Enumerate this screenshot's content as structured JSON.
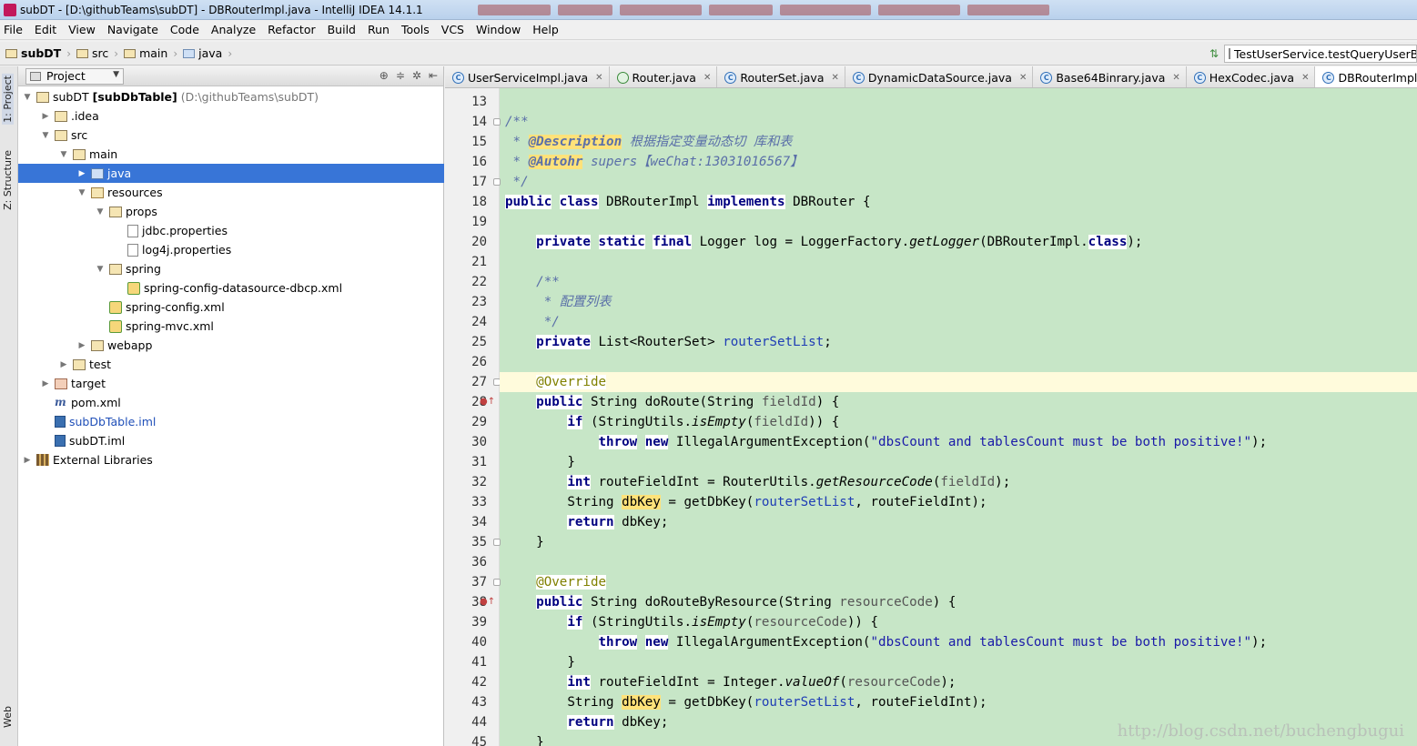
{
  "window": {
    "title": "subDT - [D:\\githubTeams\\subDT] - DBRouterImpl.java - IntelliJ IDEA 14.1.1"
  },
  "menu": [
    "File",
    "Edit",
    "View",
    "Navigate",
    "Code",
    "Analyze",
    "Refactor",
    "Build",
    "Run",
    "Tools",
    "VCS",
    "Window",
    "Help"
  ],
  "breadcrumb": [
    "subDT",
    "src",
    "main",
    "java"
  ],
  "run_config": {
    "label": "TestUserService.testQueryUserByI"
  },
  "side_tabs": {
    "project": "1: Project",
    "structure": "Z: Structure",
    "web": "Web"
  },
  "project_panel": {
    "view_mode": "Project",
    "tree": [
      {
        "name": "subDT",
        "extra": "[subDbTable]",
        "path": "(D:\\githubTeams\\subDT)",
        "depth": 0,
        "arrow": "down",
        "icon": "module"
      },
      {
        "name": ".idea",
        "depth": 1,
        "arrow": "right",
        "icon": "folder"
      },
      {
        "name": "src",
        "depth": 1,
        "arrow": "down",
        "icon": "folder"
      },
      {
        "name": "main",
        "depth": 2,
        "arrow": "down",
        "icon": "folder"
      },
      {
        "name": "java",
        "depth": 3,
        "arrow": "right",
        "icon": "src",
        "selected": true
      },
      {
        "name": "resources",
        "depth": 3,
        "arrow": "down",
        "icon": "res"
      },
      {
        "name": "props",
        "depth": 4,
        "arrow": "down",
        "icon": "folder"
      },
      {
        "name": "jdbc.properties",
        "depth": 5,
        "arrow": "",
        "icon": "file"
      },
      {
        "name": "log4j.properties",
        "depth": 5,
        "arrow": "",
        "icon": "file"
      },
      {
        "name": "spring",
        "depth": 4,
        "arrow": "down",
        "icon": "folder"
      },
      {
        "name": "spring-config-datasource-dbcp.xml",
        "depth": 5,
        "arrow": "",
        "icon": "xml"
      },
      {
        "name": "spring-config.xml",
        "depth": 4,
        "arrow": "",
        "icon": "xml"
      },
      {
        "name": "spring-mvc.xml",
        "depth": 4,
        "arrow": "",
        "icon": "xml"
      },
      {
        "name": "webapp",
        "depth": 3,
        "arrow": "right",
        "icon": "web"
      },
      {
        "name": "test",
        "depth": 2,
        "arrow": "right",
        "icon": "folder"
      },
      {
        "name": "target",
        "depth": 1,
        "arrow": "right",
        "icon": "target"
      },
      {
        "name": "pom.xml",
        "depth": 1,
        "arrow": "",
        "icon": "maven"
      },
      {
        "name": "subDbTable.iml",
        "depth": 1,
        "arrow": "",
        "icon": "iml",
        "blue": true
      },
      {
        "name": "subDT.iml",
        "depth": 1,
        "arrow": "",
        "icon": "iml"
      },
      {
        "name": "External Libraries",
        "depth": 0,
        "arrow": "right",
        "icon": "lib"
      }
    ]
  },
  "tabs": [
    {
      "name": "UserServiceImpl.java",
      "icon": "class"
    },
    {
      "name": "Router.java",
      "icon": "annotation"
    },
    {
      "name": "RouterSet.java",
      "icon": "class"
    },
    {
      "name": "DynamicDataSource.java",
      "icon": "class"
    },
    {
      "name": "Base64Binrary.java",
      "icon": "class"
    },
    {
      "name": "HexCodec.java",
      "icon": "class"
    },
    {
      "name": "DBRouterImpl.java",
      "icon": "class",
      "active": true
    }
  ],
  "editor": {
    "first_line": 13,
    "current_line": 27,
    "lines": [
      [],
      [
        [
          "/**",
          "cm"
        ]
      ],
      [
        [
          " * ",
          "cm"
        ],
        [
          "@Description",
          "dt"
        ],
        [
          " 根据指定变量动态切 库和表",
          "cm"
        ]
      ],
      [
        [
          " * ",
          "cm"
        ],
        [
          "@Autohr",
          "dt"
        ],
        [
          " supers【weChat:13031016567】",
          "cm"
        ]
      ],
      [
        [
          " */",
          "cm"
        ]
      ],
      [
        [
          "public",
          "kw"
        ],
        [
          " "
        ],
        [
          "class",
          "kw"
        ],
        [
          " DBRouterImpl "
        ],
        [
          "implements",
          "kw"
        ],
        [
          " DBRouter {"
        ]
      ],
      [],
      [
        [
          "    "
        ],
        [
          "private",
          "kw"
        ],
        [
          " "
        ],
        [
          "static",
          "kw"
        ],
        [
          " "
        ],
        [
          "final",
          "kw"
        ],
        [
          " Logger log = LoggerFactory."
        ],
        [
          "getLogger",
          "it"
        ],
        [
          "(DBRouterImpl."
        ],
        [
          "class",
          "kw"
        ],
        [
          ");"
        ]
      ],
      [],
      [
        [
          "    /**",
          "cm"
        ]
      ],
      [
        [
          "     * 配置列表",
          "cm"
        ]
      ],
      [
        [
          "     */",
          "cm"
        ]
      ],
      [
        [
          "    "
        ],
        [
          "private",
          "kw"
        ],
        [
          " List<RouterSet> "
        ],
        [
          "routerSetList",
          "fld"
        ],
        [
          ";"
        ]
      ],
      [],
      [
        [
          "    "
        ],
        [
          "@Override",
          "an"
        ]
      ],
      [
        [
          "    "
        ],
        [
          "public",
          "kw"
        ],
        [
          " String doRoute(String "
        ],
        [
          "fieldId",
          "prm"
        ],
        [
          ") {"
        ]
      ],
      [
        [
          "        "
        ],
        [
          "if",
          "kw"
        ],
        [
          " (StringUtils."
        ],
        [
          "isEmpty",
          "it"
        ],
        [
          "("
        ],
        [
          "fieldId",
          "prm"
        ],
        [
          ")) {"
        ]
      ],
      [
        [
          "            "
        ],
        [
          "throw",
          "kw"
        ],
        [
          " "
        ],
        [
          "new",
          "kw"
        ],
        [
          " IllegalArgumentException("
        ],
        [
          "\"dbsCount and tablesCount must be both positive!\"",
          "str"
        ],
        [
          ");"
        ]
      ],
      [
        [
          "        }"
        ]
      ],
      [
        [
          "        "
        ],
        [
          "int",
          "kw"
        ],
        [
          " routeFieldInt = RouterUtils."
        ],
        [
          "getResourceCode",
          "it"
        ],
        [
          "("
        ],
        [
          "fieldId",
          "prm"
        ],
        [
          ");"
        ]
      ],
      [
        [
          "        String "
        ],
        [
          "dbKey",
          "hl"
        ],
        [
          " = getDbKey("
        ],
        [
          "routerSetList",
          "fld"
        ],
        [
          ", routeFieldInt);"
        ]
      ],
      [
        [
          "        "
        ],
        [
          "return",
          "kw"
        ],
        [
          " dbKey;"
        ]
      ],
      [
        [
          "    }"
        ]
      ],
      [],
      [
        [
          "    "
        ],
        [
          "@Override",
          "an"
        ]
      ],
      [
        [
          "    "
        ],
        [
          "public",
          "kw"
        ],
        [
          " String doRouteByResource(String "
        ],
        [
          "resourceCode",
          "prm"
        ],
        [
          ") {"
        ]
      ],
      [
        [
          "        "
        ],
        [
          "if",
          "kw"
        ],
        [
          " (StringUtils."
        ],
        [
          "isEmpty",
          "it"
        ],
        [
          "("
        ],
        [
          "resourceCode",
          "prm"
        ],
        [
          ")) {"
        ]
      ],
      [
        [
          "            "
        ],
        [
          "throw",
          "kw"
        ],
        [
          " "
        ],
        [
          "new",
          "kw"
        ],
        [
          " IllegalArgumentException("
        ],
        [
          "\"dbsCount and tablesCount must be both positive!\"",
          "str"
        ],
        [
          ");"
        ]
      ],
      [
        [
          "        }"
        ]
      ],
      [
        [
          "        "
        ],
        [
          "int",
          "kw"
        ],
        [
          " routeFieldInt = Integer."
        ],
        [
          "valueOf",
          "it"
        ],
        [
          "("
        ],
        [
          "resourceCode",
          "prm"
        ],
        [
          ");"
        ]
      ],
      [
        [
          "        String "
        ],
        [
          "dbKey",
          "hl"
        ],
        [
          " = getDbKey("
        ],
        [
          "routerSetList",
          "fld"
        ],
        [
          ", routeFieldInt);"
        ]
      ],
      [
        [
          "        "
        ],
        [
          "return",
          "kw"
        ],
        [
          " dbKey;"
        ]
      ],
      [
        [
          "    }"
        ]
      ]
    ],
    "override_marks": [
      28,
      38
    ]
  },
  "watermark": "http://blog.csdn.net/buchengbugui",
  "colors": {
    "editor_bg": "#c7e6c7",
    "selection": "#3875d7",
    "keyword": "#000080",
    "comment": "#5a6fa8",
    "string": "#1a1aa8"
  }
}
